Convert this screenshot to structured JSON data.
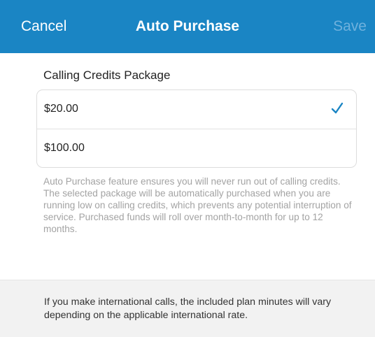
{
  "header": {
    "cancel_label": "Cancel",
    "title": "Auto Purchase",
    "save_label": "Save"
  },
  "package_section": {
    "label": "Calling Credits Package",
    "options": [
      {
        "amount": "$20.00",
        "selected": true
      },
      {
        "amount": "$100.00",
        "selected": false
      }
    ]
  },
  "description": "Auto Purchase feature ensures you will never run out of calling credits. The selected package will be automatically purchased when you are running low on calling credits, which prevents any potential interruption of service. Purchased funds will roll over month-to-month for up to 12 months.",
  "footer_note": "If you make international calls, the included plan minutes will vary depending on the applicable international rate.",
  "icons": {
    "selected_option": "checkmark-icon"
  },
  "colors": {
    "header_background": "#1a85c4",
    "header_text": "#ffffff",
    "save_disabled": "#6fb1dd",
    "checkmark": "#1a85c4",
    "description_text": "#a3a3a3",
    "footer_background": "#f2f2f2"
  }
}
